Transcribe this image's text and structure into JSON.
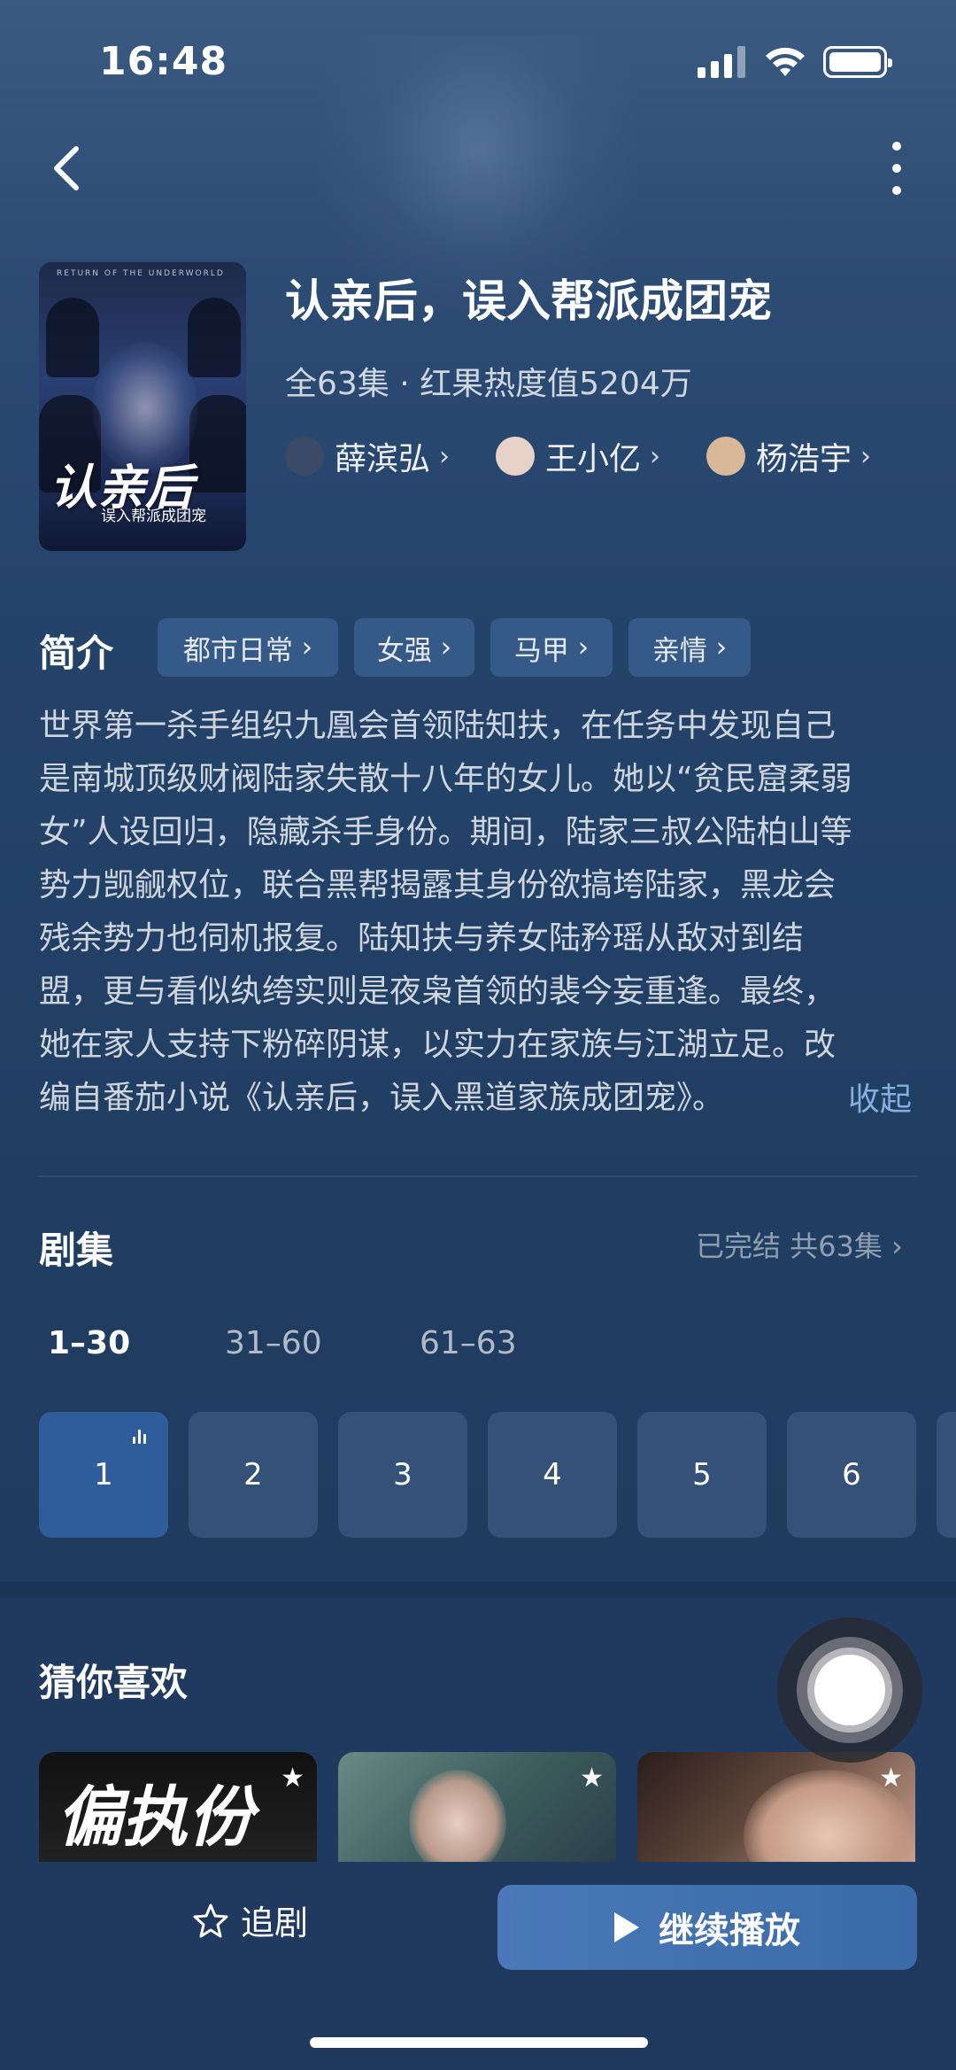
{
  "status_bar": {
    "time": "16:48"
  },
  "poster": {
    "top_text": "RETURN OF THE UNDERWORLD",
    "title": "认亲后",
    "subtitle": "误入帮派成团宠"
  },
  "drama": {
    "title": "认亲后，误入帮派成团宠",
    "meta": "全63集 · 红果热度值5204万"
  },
  "cast": [
    {
      "name": "薛滨弘",
      "avatar_color": "#3b4a66"
    },
    {
      "name": "王小亿",
      "avatar_color": "#e8d2c8"
    },
    {
      "name": "杨浩宇",
      "avatar_color": "#d9b89a"
    }
  ],
  "synopsis": {
    "label": "简介",
    "tags": [
      "都市日常",
      "女强",
      "马甲",
      "亲情"
    ],
    "lines": [
      "世界第一杀手组织九凰会首领陆知扶，在任务中发现自己",
      "是南城顶级财阀陆家失散十八年的女儿。她以“贫民窟柔弱",
      "女”人设回归，隐藏杀手身份。期间，陆家三叔公陆柏山等",
      "势力觊觎权位，联合黑帮揭露其身份欲搞垮陆家，黑龙会",
      "残余势力也伺机报复。陆知扶与养女陆矜瑶从敌对到结",
      "盟，更与看似纨绔实则是夜枭首领的裴今妄重逢。最终，",
      "她在家人支持下粉碎阴谋，以实力在家族与江湖立足。改",
      "编自番茄小说《认亲后，误入黑道家族成团宠》。"
    ],
    "collapse_label": "收起"
  },
  "episodes": {
    "label": "剧集",
    "status": "已完结 共63集",
    "ranges": [
      "1–30",
      "31–60",
      "61–63"
    ],
    "active_range": 0,
    "items": [
      "1",
      "2",
      "3",
      "4",
      "5",
      "6"
    ],
    "active_episode": 0
  },
  "recommend": {
    "label": "猜你喜欢",
    "cards": [
      {
        "poster_text": "偏执份"
      },
      {
        "poster_text": ""
      },
      {
        "poster_text": ""
      }
    ]
  },
  "bottom": {
    "follow_label": "追剧",
    "play_label": "继续播放"
  },
  "colors": {
    "background": "#1f3a5e",
    "accent": "#3a6aa8",
    "active_episode": "#2f5d9c",
    "link": "#8cb4e6"
  }
}
